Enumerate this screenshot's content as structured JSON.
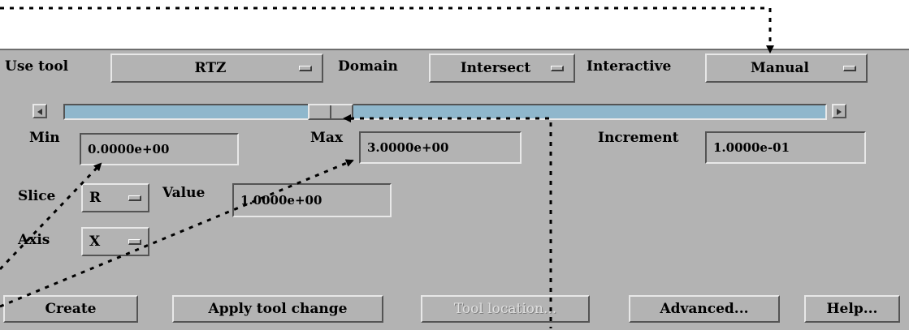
{
  "tool": {
    "label": "Use tool",
    "value": "RTZ"
  },
  "domain": {
    "label": "Domain",
    "value": "Intersect"
  },
  "interactive": {
    "label": "Interactive",
    "value": "Manual"
  },
  "slider": {
    "position_fraction": 0.34
  },
  "min": {
    "label": "Min",
    "value": "0.0000e+00"
  },
  "max": {
    "label": "Max",
    "value": "3.0000e+00"
  },
  "increment": {
    "label": "Increment",
    "value": "1.0000e-01"
  },
  "slice": {
    "label": "Slice",
    "value": "R"
  },
  "slice_value": {
    "label": "Value",
    "value": "1.0000e+00"
  },
  "axis": {
    "label": "Axis",
    "value": "X"
  },
  "buttons": {
    "create": "Create",
    "apply": "Apply tool change",
    "tool_location": "Tool location...",
    "advanced": "Advanced...",
    "help": "Help..."
  },
  "colors": {
    "panel": "#b3b3b3",
    "trough": "#8fb7cc",
    "annotation": "#000000"
  },
  "icons": {
    "scroll_left": "triangle-left-icon",
    "scroll_right": "triangle-right-icon"
  }
}
